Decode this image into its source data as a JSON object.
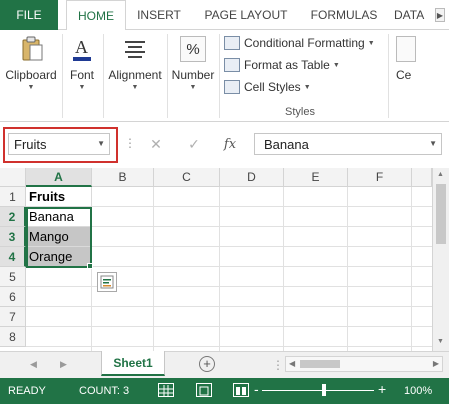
{
  "ribbon_tabs": [
    "FILE",
    "HOME",
    "INSERT",
    "PAGE LAYOUT",
    "FORMULAS",
    "DATA"
  ],
  "active_tab": "HOME",
  "ribbon": {
    "clipboard": "Clipboard",
    "font": "Font",
    "alignment": "Alignment",
    "number": "Number",
    "conditional_formatting": "Conditional Formatting",
    "format_as_table": "Format as Table",
    "cell_styles": "Cell Styles",
    "styles_group": "Styles",
    "cells_partial": "Ce"
  },
  "formula_bar": {
    "name_box": "Fruits",
    "fx": "fx",
    "value": "Banana"
  },
  "grid": {
    "columns": [
      "A",
      "B",
      "C",
      "D",
      "E",
      "F"
    ],
    "rows": [
      "1",
      "2",
      "3",
      "4",
      "5",
      "6",
      "7",
      "8"
    ],
    "cells": {
      "A1": "Fruits",
      "A2": "Banana",
      "A3": "Mango",
      "A4": "Orange"
    }
  },
  "sheets": [
    "Sheet1"
  ],
  "status": {
    "ready": "READY",
    "count": "COUNT: 3",
    "zoom": "100%",
    "minus": "-",
    "plus": "+"
  },
  "colors": {
    "excel_green": "#217346",
    "highlight_red": "#d0312d",
    "selection_shade": "#c6c6c6"
  }
}
